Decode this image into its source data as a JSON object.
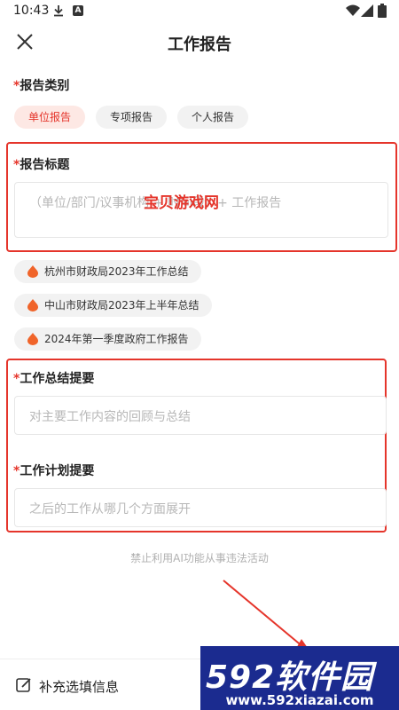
{
  "status": {
    "time": "10:43"
  },
  "nav": {
    "title": "工作报告"
  },
  "report_type": {
    "label": "报告类别",
    "options": [
      "单位报告",
      "专项报告",
      "个人报告"
    ],
    "selected": "单位报告"
  },
  "report_title": {
    "label": "报告标题",
    "placeholder": "（单位/部门/议事机构 + 时间段）+ 工作报告"
  },
  "suggestions": [
    "杭州市财政局2023年工作总结",
    "中山市财政局2023年上半年总结",
    "2024年第一季度政府工作报告"
  ],
  "summary": {
    "label": "工作总结提要",
    "placeholder": "对主要工作内容的回顾与总结"
  },
  "plan": {
    "label": "工作计划提要",
    "placeholder": "之后的工作从哪几个方面展开"
  },
  "notice": "禁止利用AI功能从事违法活动",
  "bottom": {
    "supplement_label": "补充选填信息"
  },
  "watermark": "宝贝游戏网",
  "brand": {
    "title": "592软件园",
    "url": "www.592xiazai.com"
  },
  "colors": {
    "accent": "#e5352b",
    "chip_active_bg": "#fde8e4"
  },
  "required_mark": "*"
}
